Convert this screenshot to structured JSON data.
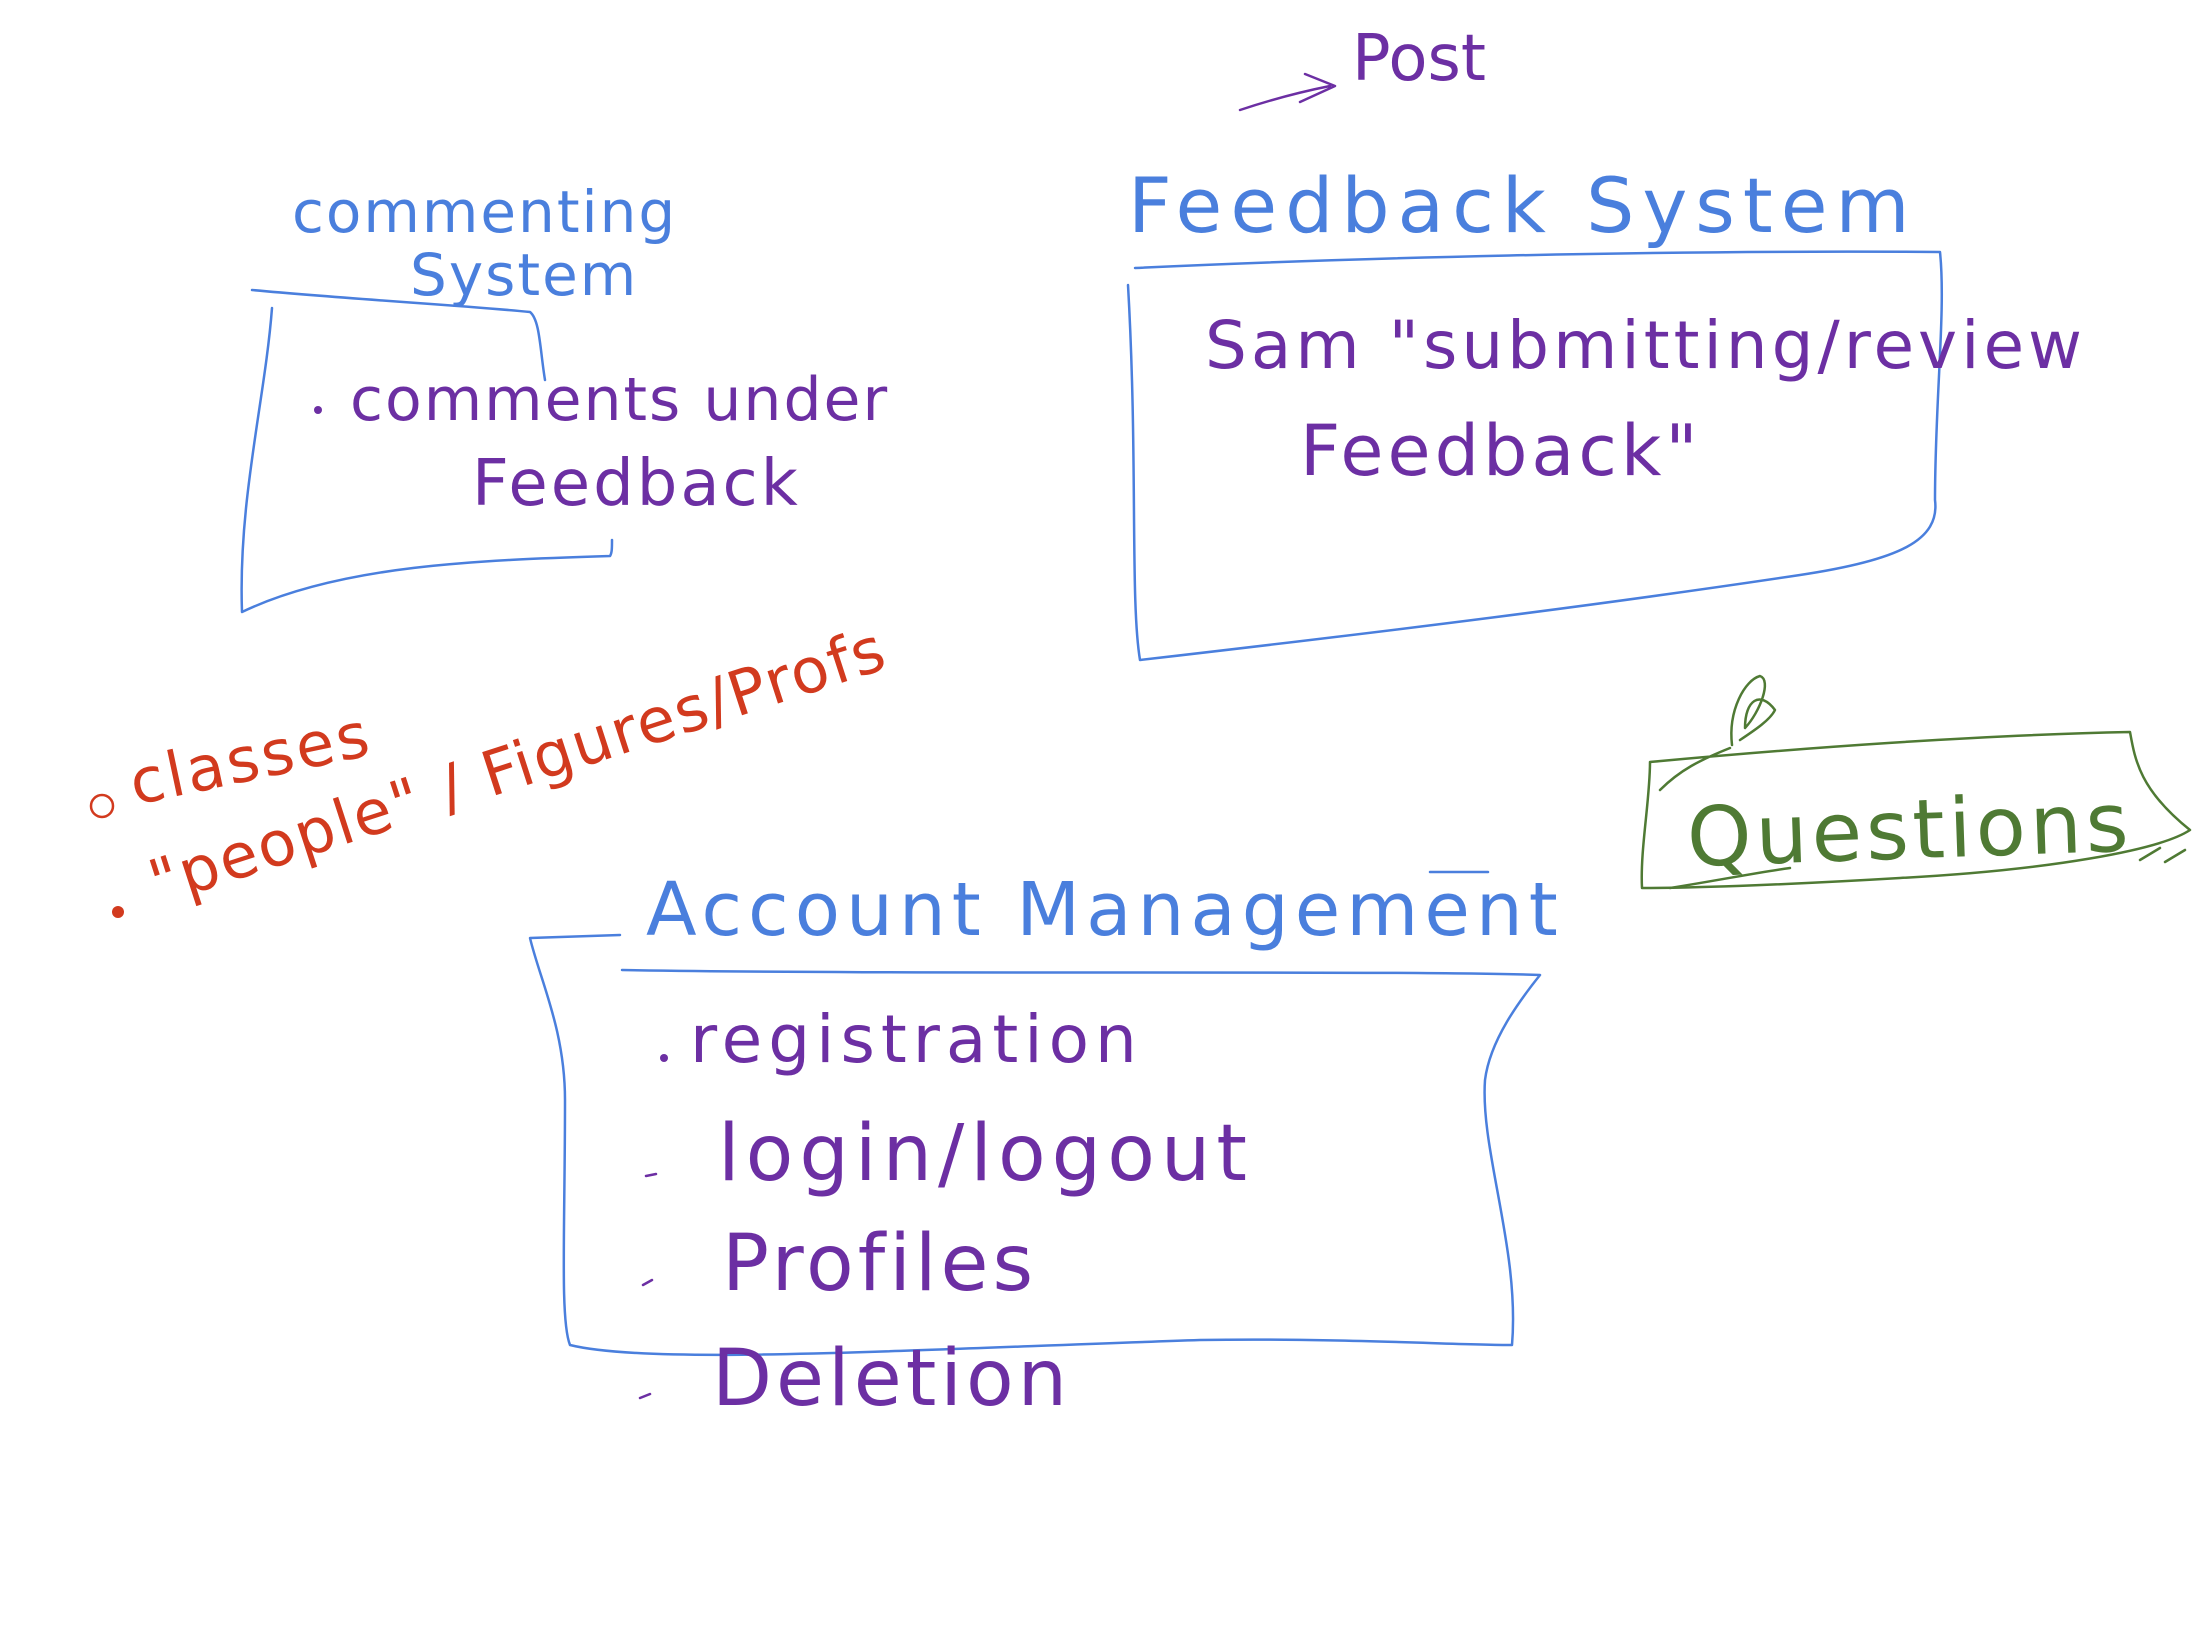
{
  "colors": {
    "blue": "#4a7fdd",
    "purple": "#6c2fa3",
    "red": "#d23a1e",
    "green": "#4f7a34"
  },
  "post_note": "Post",
  "feedback_system": {
    "title": "Feedback System",
    "line1": "Sam \"submitting/review",
    "line2": "Feedback\""
  },
  "commenting_system": {
    "title_line1": "commenting",
    "title_line2": "System",
    "item_line1": "comments under",
    "item_line2": "Feedback"
  },
  "side_notes": {
    "line1": "classes",
    "line2": "\"people\" / Figures/Profs"
  },
  "questions": {
    "label": "Questions"
  },
  "account_management": {
    "title": "Account Management",
    "items": [
      "registration",
      "login/logout",
      "Profiles",
      "Deletion"
    ]
  }
}
